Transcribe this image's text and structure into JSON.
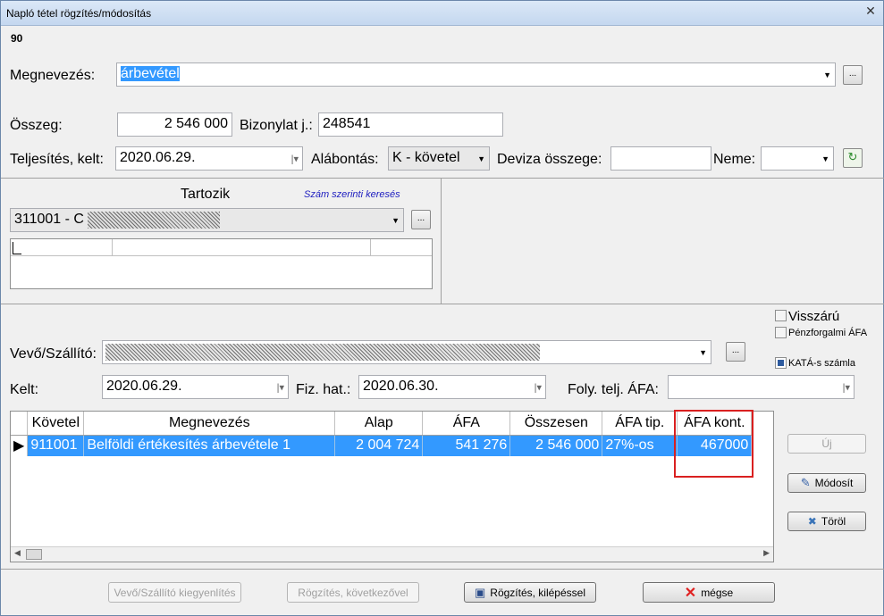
{
  "window": {
    "title": "Napló tétel rögzítés/módosítás",
    "id_number": "90"
  },
  "form": {
    "megnevezes_label": "Megnevezés:",
    "megnevezes_value": "árbevétel",
    "osszeg_label": "Összeg:",
    "osszeg_value": "2 546 000",
    "bizonylat_label": "Bizonylat j.:",
    "bizonylat_value": "248541",
    "teljesites_label": "Teljesítés, kelt:",
    "teljesites_value": "2020.06.29.",
    "alabontas_label": "Alábontás:",
    "alabontas_value": "K - követel",
    "deviza_label": "Deviza összege:",
    "deviza_value": "",
    "neme_label": "Neme:",
    "neme_value": ""
  },
  "tartozik": {
    "title": "Tartozik",
    "search_link": "Szám szerinti keresés",
    "account_value": "311001 - C"
  },
  "partner": {
    "checkbox_visszaru": "Visszárú",
    "checkbox_penzforgalmi": "Pénzforgalmi ÁFA",
    "checkbox_kata": "KATÁ-s számla",
    "vevo_label": "Vevő/Szállító:",
    "kelt_label": "Kelt:",
    "kelt_value": "2020.06.29.",
    "fiz_label": "Fiz. hat.:",
    "fiz_value": "2020.06.30.",
    "foly_label": "Foly. telj. ÁFA:",
    "foly_value": ""
  },
  "grid": {
    "headers": [
      "Követel",
      "Megnevezés",
      "Alap",
      "ÁFA",
      "Összesen",
      "ÁFA tip.",
      "ÁFA kont."
    ],
    "rows": [
      [
        "911001",
        "Belföldi értékesítés árbevétele 1",
        "2 004 724",
        "541 276",
        "2 546 000",
        "27%-os",
        "467000"
      ]
    ]
  },
  "side_buttons": {
    "uj": "Új",
    "modosit": "Módosít",
    "torol": "Töröl"
  },
  "bottom_buttons": {
    "kiegyenlites": "Vevő/Szállító kiegyenlítés",
    "kovetkezovel": "Rögzítés, következővel",
    "kilepessel": "Rögzítés, kilépéssel",
    "megse": "mégse"
  },
  "colors": {
    "selection": "#3399ff",
    "highlight_box": "#d92020",
    "cancel_x": "#e02020"
  }
}
